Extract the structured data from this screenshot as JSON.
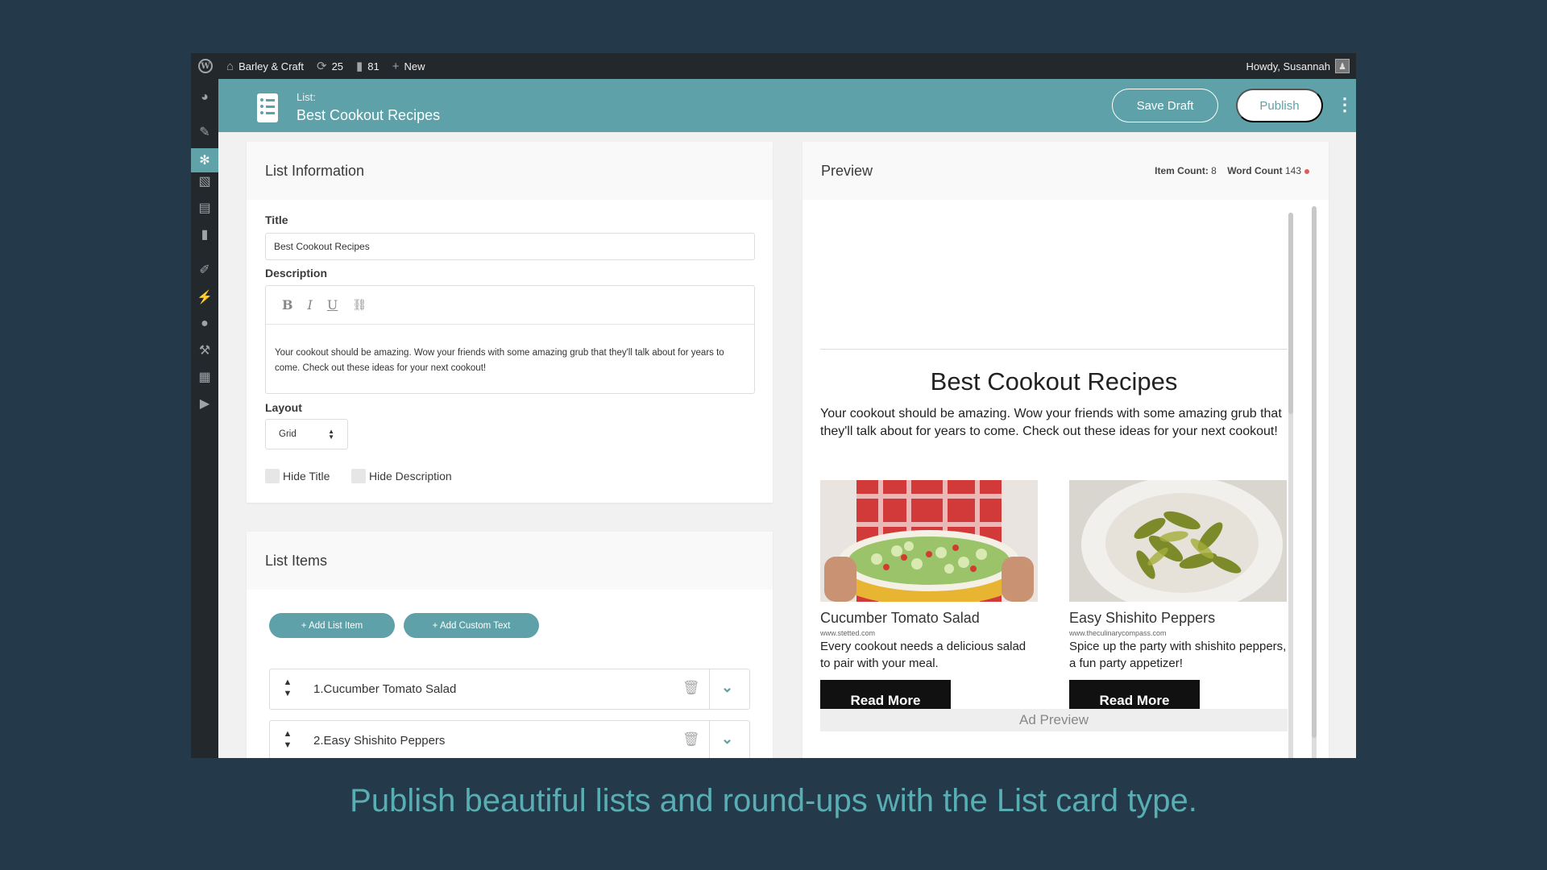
{
  "adminbar": {
    "site_name": "Barley & Craft",
    "updates_count": "25",
    "comments_count": "81",
    "new_label": "New",
    "howdy": "Howdy, Susannah"
  },
  "sidebar": {
    "items": [
      "dashboard-icon",
      "pin-icon",
      "settings-icon",
      "media-icon",
      "pages-icon",
      "comments-icon",
      "brush-icon",
      "plugins-icon",
      "users-icon",
      "tools-icon",
      "grid-icon",
      "play-icon"
    ],
    "active": 2
  },
  "header": {
    "type_label": "List:",
    "title": "Best Cookout Recipes",
    "save_draft": "Save Draft",
    "publish": "Publish",
    "accent": "#5ea1a9"
  },
  "info": {
    "heading": "List Information",
    "title_label": "Title",
    "title_value": "Best Cookout Recipes",
    "description_label": "Description",
    "toolbar": {
      "bold": "B",
      "italic": "I",
      "underline": "U"
    },
    "description_value": "Your cookout should be amazing. Wow your friends with some amazing grub that they'll talk about for years to come. Check out these ideas for your next cookout!",
    "layout_label": "Layout",
    "layout_value": "Grid",
    "hide_title": "Hide Title",
    "hide_description": "Hide Description"
  },
  "list_items": {
    "heading": "List Items",
    "add_item": "+ Add List Item",
    "add_text": "+ Add Custom Text",
    "rows": [
      {
        "num": "1.",
        "label": "Cucumber Tomato Salad"
      },
      {
        "num": "2.",
        "label": "Easy Shishito Peppers"
      }
    ]
  },
  "preview": {
    "heading": "Preview",
    "item_count_label": "Item Count:",
    "item_count": "8",
    "word_count_label": "Word Count",
    "word_count": "143",
    "title": "Best Cookout Recipes",
    "description": "Your cookout should be amazing. Wow your friends with some amazing grub that they'll talk about for years to come. Check out these ideas for your next cookout!",
    "cards": [
      {
        "title": "Cucumber Tomato Salad",
        "source": "www.stetted.com",
        "desc": "Every cookout needs a delicious salad to pair with your meal.",
        "button": "Read More"
      },
      {
        "title": "Easy Shishito Peppers",
        "source": "www.theculinarycompass.com",
        "desc": "Spice up the party with shishito peppers, a fun party appetizer!",
        "button": "Read More"
      }
    ],
    "ad_preview": "Ad Preview"
  },
  "tagline": "Publish beautiful lists and round-ups with the List card type."
}
